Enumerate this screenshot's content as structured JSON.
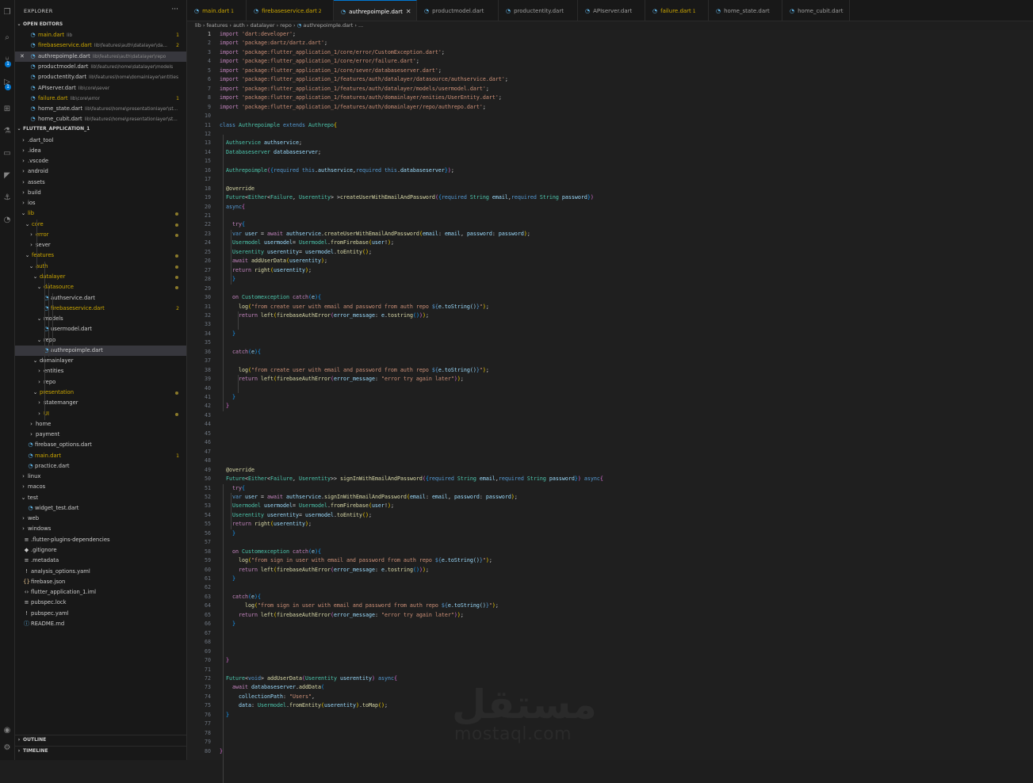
{
  "explorer": {
    "title": "EXPLORER",
    "more": "···",
    "open_editors_label": "OPEN EDITORS",
    "open_editors": [
      {
        "name": "main.dart",
        "path": "lib",
        "count": "1",
        "modified": true
      },
      {
        "name": "firebaseservice.dart",
        "path": "lib\\features\\auth\\datalayer\\da...",
        "count": "2",
        "modified": true
      },
      {
        "name": "authrepoimple.dart",
        "path": "lib\\features\\auth\\datalayer\\repo",
        "count": "",
        "modified": false,
        "active": true
      },
      {
        "name": "productmodel.dart",
        "path": "lib\\features\\home\\datalayer\\models",
        "count": "",
        "modified": false
      },
      {
        "name": "productentity.dart",
        "path": "lib\\features\\home\\domainlayer\\entities",
        "count": "",
        "modified": false
      },
      {
        "name": "APIserver.dart",
        "path": "lib\\core\\sever",
        "count": "",
        "modified": false
      },
      {
        "name": "failure.dart",
        "path": "lib\\core\\error",
        "count": "1",
        "modified": true
      },
      {
        "name": "home_state.dart",
        "path": "lib\\features\\home\\presentationlayer\\st...",
        "count": "",
        "modified": false
      },
      {
        "name": "home_cubit.dart",
        "path": "lib\\features\\home\\presentationlayer\\st...",
        "count": "",
        "modified": false
      }
    ],
    "project_label": "FLUTTER_APPLICATION_1",
    "tree": [
      {
        "name": ".dart_tool",
        "kind": "folder",
        "open": false,
        "depth": 0
      },
      {
        "name": ".idea",
        "kind": "folder",
        "open": false,
        "depth": 0
      },
      {
        "name": ".vscode",
        "kind": "folder",
        "open": false,
        "depth": 0
      },
      {
        "name": "android",
        "kind": "folder",
        "open": false,
        "depth": 0
      },
      {
        "name": "assets",
        "kind": "folder",
        "open": false,
        "depth": 0
      },
      {
        "name": "build",
        "kind": "folder",
        "open": false,
        "depth": 0
      },
      {
        "name": "ios",
        "kind": "folder",
        "open": false,
        "depth": 0
      },
      {
        "name": "lib",
        "kind": "folder",
        "open": true,
        "depth": 0,
        "modified": true,
        "dot": true
      },
      {
        "name": "core",
        "kind": "folder",
        "open": true,
        "depth": 1,
        "modified": true,
        "dot": true
      },
      {
        "name": "error",
        "kind": "folder",
        "open": false,
        "depth": 2,
        "modified": true,
        "dot": true
      },
      {
        "name": "sever",
        "kind": "folder",
        "open": false,
        "depth": 2
      },
      {
        "name": "features",
        "kind": "folder",
        "open": true,
        "depth": 1,
        "modified": true,
        "dot": true
      },
      {
        "name": "auth",
        "kind": "folder",
        "open": true,
        "depth": 2,
        "modified": true,
        "dot": true
      },
      {
        "name": "datalayer",
        "kind": "folder",
        "open": true,
        "depth": 3,
        "modified": true,
        "dot": true
      },
      {
        "name": "datasource",
        "kind": "folder",
        "open": true,
        "depth": 4,
        "modified": true,
        "dot": true
      },
      {
        "name": "authservice.dart",
        "kind": "dart",
        "depth": 5
      },
      {
        "name": "firebaseservice.dart",
        "kind": "dart",
        "depth": 5,
        "modified": true,
        "count": "2"
      },
      {
        "name": "models",
        "kind": "folder",
        "open": true,
        "depth": 4
      },
      {
        "name": "usermodel.dart",
        "kind": "dart",
        "depth": 5
      },
      {
        "name": "repo",
        "kind": "folder",
        "open": true,
        "depth": 4
      },
      {
        "name": "authrepoimple.dart",
        "kind": "dart",
        "depth": 5,
        "selected": true
      },
      {
        "name": "domainlayer",
        "kind": "folder",
        "open": true,
        "depth": 3
      },
      {
        "name": "entities",
        "kind": "folder",
        "open": false,
        "depth": 4
      },
      {
        "name": "repo",
        "kind": "folder",
        "open": false,
        "depth": 4
      },
      {
        "name": "presentation",
        "kind": "folder",
        "open": true,
        "depth": 3,
        "modified": true,
        "dot": true
      },
      {
        "name": "statemanger",
        "kind": "folder",
        "open": false,
        "depth": 4
      },
      {
        "name": "UI",
        "kind": "folder",
        "open": false,
        "depth": 4,
        "modified": true,
        "dot": true
      },
      {
        "name": "home",
        "kind": "folder",
        "open": false,
        "depth": 2
      },
      {
        "name": "payment",
        "kind": "folder",
        "open": false,
        "depth": 2
      },
      {
        "name": "firebase_options.dart",
        "kind": "dart",
        "depth": 1
      },
      {
        "name": "main.dart",
        "kind": "dart",
        "depth": 1,
        "modified": true,
        "count": "1"
      },
      {
        "name": "practice.dart",
        "kind": "dart",
        "depth": 1
      },
      {
        "name": "linux",
        "kind": "folder",
        "open": false,
        "depth": 0
      },
      {
        "name": "macos",
        "kind": "folder",
        "open": false,
        "depth": 0
      },
      {
        "name": "test",
        "kind": "folder",
        "open": true,
        "depth": 0
      },
      {
        "name": "widget_test.dart",
        "kind": "dart",
        "depth": 1
      },
      {
        "name": "web",
        "kind": "folder",
        "open": false,
        "depth": 0
      },
      {
        "name": "windows",
        "kind": "folder",
        "open": false,
        "depth": 0
      },
      {
        "name": ".flutter-plugins-dependencies",
        "kind": "lines",
        "depth": 0
      },
      {
        "name": ".gitignore",
        "kind": "git",
        "depth": 0
      },
      {
        "name": ".metadata",
        "kind": "lines",
        "depth": 0
      },
      {
        "name": "analysis_options.yaml",
        "kind": "yaml",
        "depth": 0
      },
      {
        "name": "firebase.json",
        "kind": "json",
        "depth": 0
      },
      {
        "name": "flutter_application_1.iml",
        "kind": "xml",
        "depth": 0
      },
      {
        "name": "pubspec.lock",
        "kind": "lines",
        "depth": 0
      },
      {
        "name": "pubspec.yaml",
        "kind": "yaml",
        "depth": 0
      },
      {
        "name": "README.md",
        "kind": "info",
        "depth": 0
      }
    ],
    "outline_label": "OUTLINE",
    "timeline_label": "TIMELINE"
  },
  "activity_badges": [
    "1",
    "1"
  ],
  "tabs": [
    {
      "name": "main.dart",
      "count": "1",
      "modified": true
    },
    {
      "name": "firebaseservice.dart",
      "count": "2",
      "modified": true
    },
    {
      "name": "authrepoimple.dart",
      "count": "",
      "active": true
    },
    {
      "name": "productmodel.dart",
      "count": ""
    },
    {
      "name": "productentity.dart",
      "count": ""
    },
    {
      "name": "APIserver.dart",
      "count": ""
    },
    {
      "name": "failure.dart",
      "count": "1",
      "modified": true
    },
    {
      "name": "home_state.dart",
      "count": ""
    },
    {
      "name": "home_cubit.dart",
      "count": ""
    }
  ],
  "close_glyph": "✕",
  "breadcrumb": [
    "lib",
    "features",
    "auth",
    "datalayer",
    "repo",
    "authrepoimple.dart",
    "..."
  ],
  "code_lines": [
    "import 'dart:developer';",
    "import 'package:dartz/dartz.dart';",
    "import 'package:flutter_application_1/core/error/CustomException.dart';",
    "import 'package:flutter_application_1/core/error/failure.dart';",
    "import 'package:flutter_application_1/core/sever/databaseserver.dart';",
    "import 'package:flutter_application_1/features/auth/datalayer/datasource/authservice.dart';",
    "import 'package:flutter_application_1/features/auth/datalayer/models/usermodel.dart';",
    "import 'package:flutter_application_1/features/auth/domainlayer/enities/UserEntity.dart';",
    "import 'package:flutter_application_1/features/auth/domainlayer/repo/authrepo.dart';",
    "",
    "class Authrepoimple extends Authrepo{",
    "",
    "  Authservice authservice;",
    "  Databaseserver databaseserver;",
    "",
    "  Authrepoimple({required this.authservice,required this.databaseserver});",
    "",
    "  @override",
    "  Future<Either<Failure, Userentity> >createUserWithEmailAndPassword({required String email,required String password})",
    "  async{",
    "",
    "    try{",
    "    var user = await authservice.createUserWithEmailAndPassword(email: email, password: password);",
    "    Usermodel usermodel= Usermodel.fromFirebase(user!);",
    "    Userentity userentity= usermodel.toEntity();",
    "    await addUserData(userentity);",
    "    return right(userentity);",
    "    }",
    "",
    "    on Customexception catch(e){",
    "      log(\"from create user with email and password from auth repo ${e.toString()}\");",
    "      return left(firebaseAuthError(error_message: e.tostring()));",
    "",
    "    }",
    "",
    "    catch(e){",
    "",
    "      log(\"from create user with email and password from auth repo ${e.toString()}\");",
    "      return left(firebaseAuthError(error_message: \"error try again later\"));",
    "",
    "    }",
    "  }",
    "",
    "",
    "",
    "",
    "",
    "",
    "  @override",
    "  Future<Either<Failure, Userentity>> signInWithEmailAndPassword({required String email,required String password}) async{",
    "    try{",
    "    var user = await authservice.signInWithEmailAndPassword(email: email, password: password);",
    "    Usermodel usermodel= Usermodel.fromFirebase(user!);",
    "    Userentity userentity= usermodel.toEntity();",
    "    return right(userentity);",
    "    }",
    "",
    "    on Customexception catch(e){",
    "      log(\"from sign in user with email and password from auth repo ${e.toString()}\");",
    "      return left(firebaseAuthError(error_message: e.tostring()));",
    "    }",
    "",
    "    catch(e){",
    "        log(\"from sign in user with email and password from auth repo ${e.toString()}\");",
    "      return left(firebaseAuthError(error_message: \"error try again later\"));",
    "    }",
    "",
    "",
    "",
    "  }",
    "",
    "  Future<void> addUserData(Userentity userentity) async{",
    "    await databaseserver.addData(",
    "      collectionPath: \"Users\",",
    "      data: Usermodel.fromEntity(userentity).toMap();",
    "  }",
    "",
    "",
    "",
    "}"
  ],
  "current_line": 1,
  "watermark": {
    "arabic": "مستقل",
    "latin": "mostaql.com"
  }
}
